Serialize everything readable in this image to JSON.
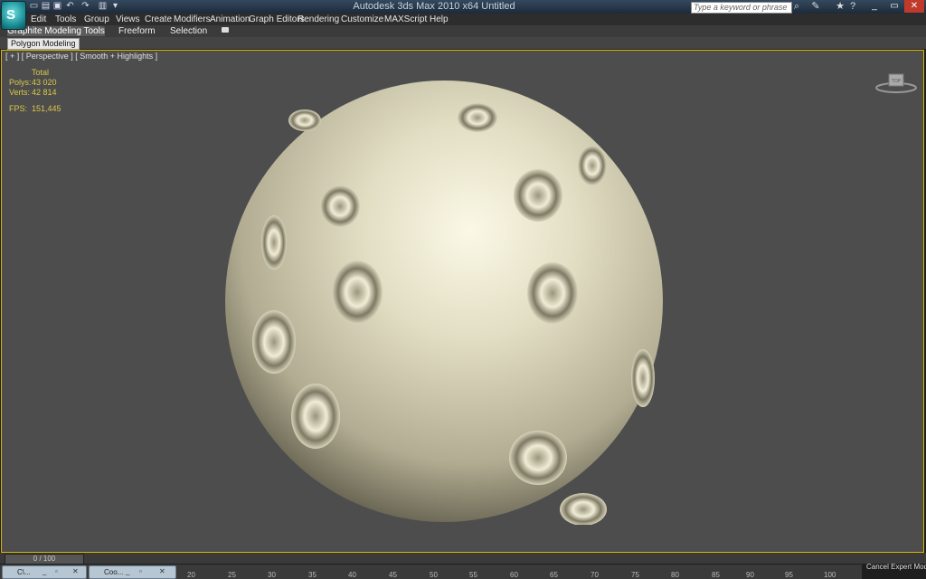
{
  "window": {
    "title": "Autodesk 3ds Max  2010 x64        Untitled"
  },
  "app_button": {
    "label": "S"
  },
  "menu": [
    "Edit",
    "Tools",
    "Group",
    "Views",
    "Create",
    "Modifiers",
    "Animation",
    "Graph Editors",
    "Rendering",
    "Customize",
    "MAXScript",
    "Help"
  ],
  "search": {
    "placeholder": "Type a keyword or phrase"
  },
  "ribbon": {
    "tabs": [
      "Graphite Modeling Tools",
      "Freeform",
      "Selection"
    ],
    "panel_label": "Polygon Modeling"
  },
  "viewport": {
    "label": "[ + ] [ Perspective ] [ Smooth + Highlights ]",
    "stats": {
      "header": "Total",
      "polys_label": "Polys:",
      "polys_value": "43 020",
      "verts_label": "Verts:",
      "verts_value": "42 814",
      "fps_label": "FPS:",
      "fps_value": "151,445"
    }
  },
  "timeline": {
    "slider": "0 / 100",
    "ticks": [
      "20",
      "25",
      "30",
      "35",
      "40",
      "45",
      "50",
      "55",
      "60",
      "65",
      "70",
      "75",
      "80",
      "85",
      "90",
      "95",
      "100"
    ]
  },
  "status": {
    "cancel_expert": "Cancel Expert Mode"
  },
  "taskbar": {
    "items": [
      "C\\...",
      "Coo..."
    ]
  },
  "colors": {
    "viewport_border": "#d9b400",
    "stats_text": "#d9c84a",
    "sphere": "#d8d4b6"
  }
}
